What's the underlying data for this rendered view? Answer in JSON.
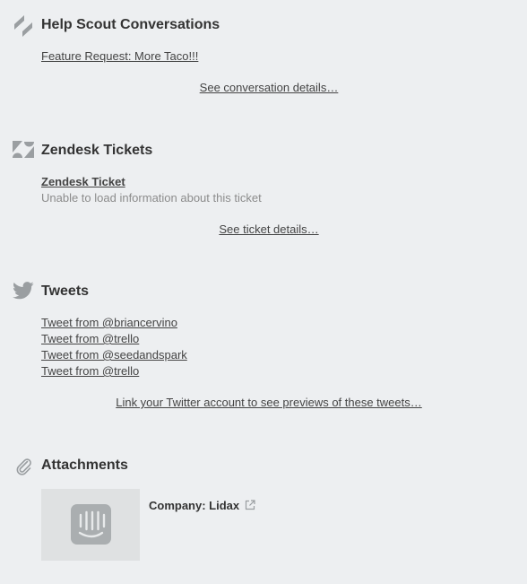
{
  "helpscout": {
    "icon": "helpscout-icon",
    "title": "Help Scout Conversations",
    "conversation_link": "Feature Request: More Taco!!!",
    "details_link": "See conversation details…"
  },
  "zendesk": {
    "icon": "zendesk-icon",
    "title": "Zendesk Tickets",
    "ticket_link": "Zendesk Ticket",
    "error_text": "Unable to load information about this ticket",
    "details_link": "See ticket details…"
  },
  "tweets": {
    "icon": "twitter-icon",
    "title": "Tweets",
    "items": [
      "Tweet from @briancervino",
      "Tweet from @trello",
      "Tweet from @seedandspark",
      "Tweet from @trello"
    ],
    "link_account": "Link your Twitter account to see previews of these tweets…"
  },
  "attachments": {
    "icon": "paperclip-icon",
    "title": "Attachments",
    "items": [
      {
        "thumbnail_icon": "intercom-logo-icon",
        "title": "Company: Lidax",
        "link_icon": "external-link-icon"
      }
    ]
  },
  "colors": {
    "background": "#edeff1",
    "icon_gray": "#9a9ea1",
    "title_text": "#333333",
    "link_text": "#444444",
    "muted_text": "#8c8c8c",
    "thumbnail_bg": "#dfe1e2"
  }
}
